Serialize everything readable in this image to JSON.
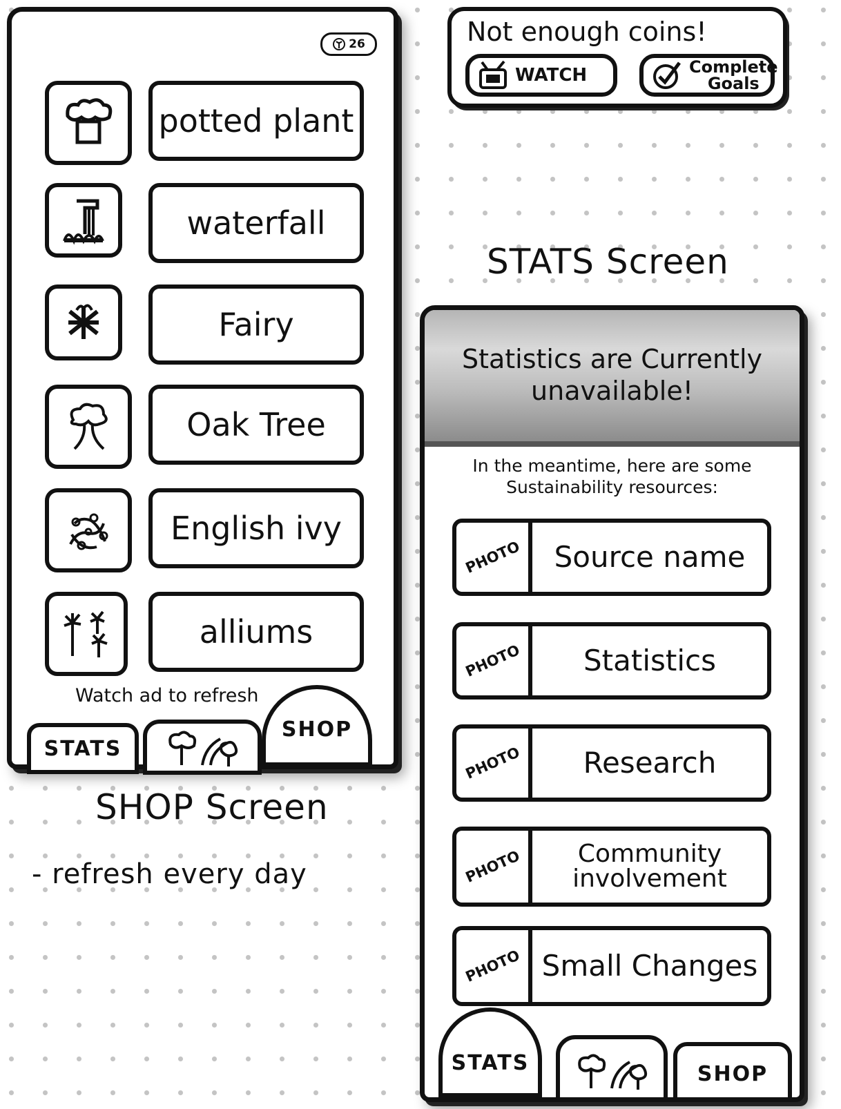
{
  "popup": {
    "title": "Not enough coins!",
    "watch_label": "WATCH",
    "goals_label": "Complete Goals"
  },
  "shop_screen": {
    "coin_count": "26",
    "items": [
      {
        "name": "potted plant",
        "icon": "potted-plant-icon"
      },
      {
        "name": "waterfall",
        "icon": "waterfall-icon"
      },
      {
        "name": "Fairy",
        "icon": "fairy-icon"
      },
      {
        "name": "Oak Tree",
        "icon": "oak-tree-icon"
      },
      {
        "name": "English ivy",
        "icon": "english-ivy-icon"
      },
      {
        "name": "alliums",
        "icon": "alliums-icon"
      }
    ],
    "refresh_note": "Watch ad to refresh",
    "nav": {
      "stats": "STATS",
      "shop": "SHOP"
    }
  },
  "captions": {
    "stats": "STATS Screen",
    "shop": "SHOP Screen",
    "shop_note": "- refresh every day"
  },
  "stats_screen": {
    "banner": "Statistics are Currently unavailable!",
    "intro": "In the meantime, here are some Sustainability resources:",
    "photo_label": "PHOTO",
    "resources": [
      {
        "title": "Source name"
      },
      {
        "title": "Statistics"
      },
      {
        "title": "Research"
      },
      {
        "title": "Community involvement"
      },
      {
        "title": "Small Changes"
      }
    ],
    "nav": {
      "stats": "STATS",
      "shop": "SHOP"
    }
  },
  "colors": {
    "ink": "#111111",
    "paper": "#ffffff",
    "dot": "#c4c4c4",
    "banner_gray": "#bdbdbd"
  }
}
